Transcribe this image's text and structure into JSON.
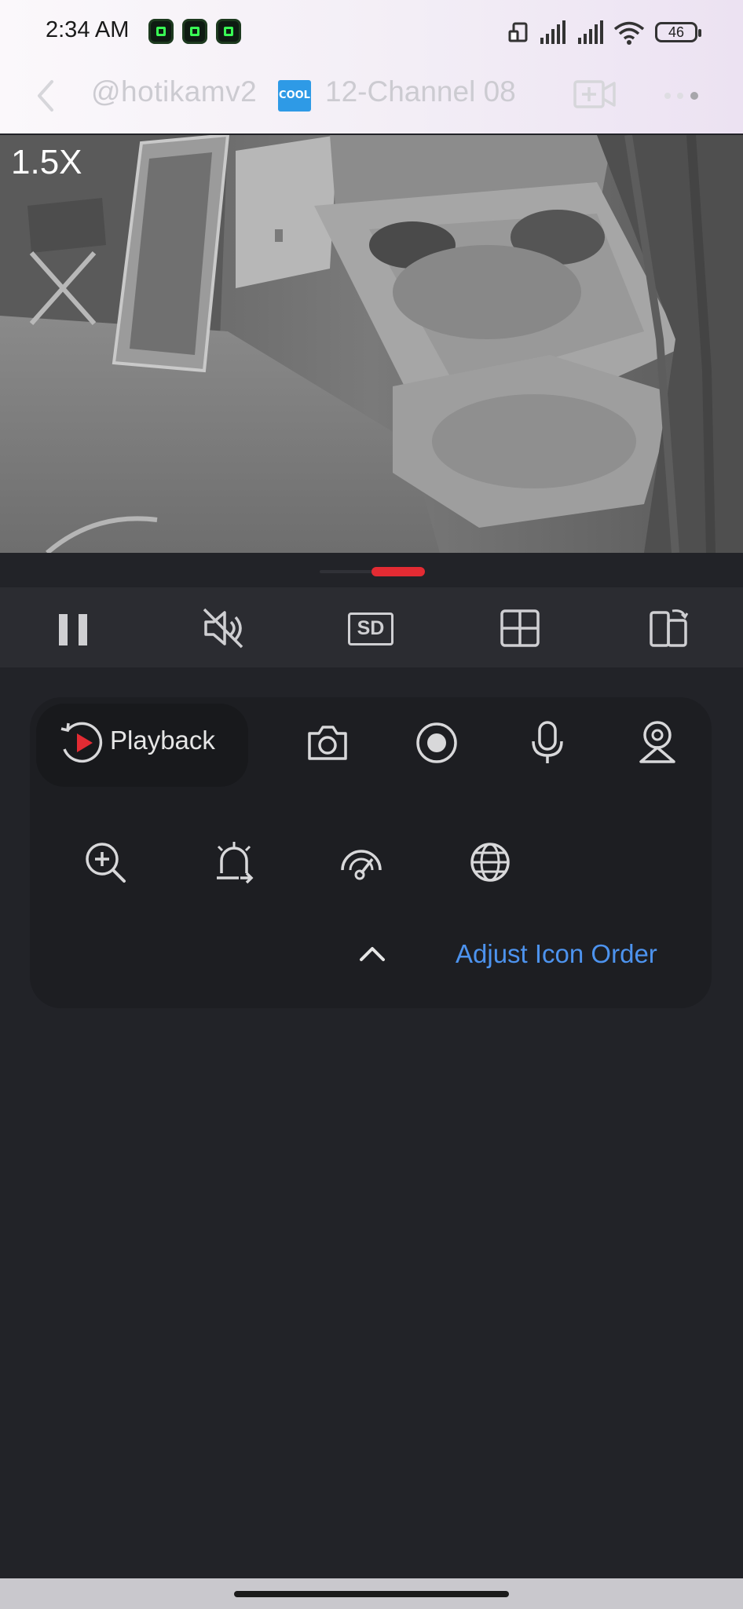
{
  "status_bar": {
    "time": "2:34 AM",
    "battery": "46",
    "icons": [
      "app-notification-icon",
      "app-notification-icon",
      "app-notification-icon",
      "screen-rotate-icon",
      "signal-icon",
      "signal-icon",
      "wifi-icon",
      "battery-icon"
    ]
  },
  "header": {
    "title": "@hotikamv2",
    "badge": "COOL",
    "subtitle": "12-Channel 08"
  },
  "video": {
    "zoom": "1.5X"
  },
  "controls": [
    "pause-icon",
    "mute-icon",
    "sd-quality-icon",
    "grid-view-icon",
    "screen-switch-icon"
  ],
  "quality_label": "SD",
  "panel": {
    "playback_label": "Playback",
    "tools_row1": [
      "camera-snapshot-icon",
      "record-icon",
      "microphone-icon",
      "ptz-camera-icon"
    ],
    "tools_row2": [
      "zoom-in-icon",
      "alarm-icon",
      "speed-dome-icon",
      "globe-icon"
    ],
    "adjust_label": "Adjust Icon Order"
  },
  "colors": {
    "accent_red": "#e32b33",
    "link_blue": "#4d93ee",
    "background": "#222328"
  }
}
